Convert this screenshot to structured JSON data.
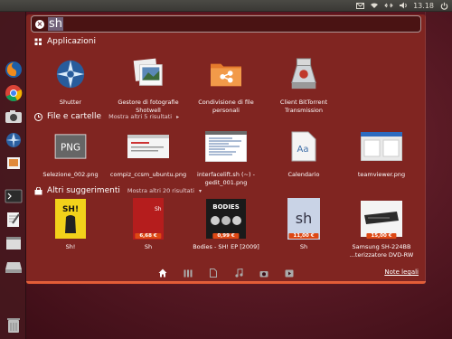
{
  "panel": {
    "time": "13.18"
  },
  "search": {
    "query": "sh"
  },
  "sections": {
    "apps": {
      "title": "Applicazioni"
    },
    "files": {
      "title": "File e cartelle",
      "more": "Mostra altri 5 risultati"
    },
    "suggestions": {
      "title": "Altri suggerimenti",
      "more": "Mostra altri 20 risultati"
    }
  },
  "apps": [
    {
      "label": "Shutter",
      "icon": "shutter-icon"
    },
    {
      "label": "Gestore di fotografie Shotwell",
      "icon": "shotwell-icon"
    },
    {
      "label": "Condivisione di file personali",
      "icon": "folder-share-icon"
    },
    {
      "label": "Client BitTorrent Transmission",
      "icon": "transmission-icon"
    }
  ],
  "files": [
    {
      "label": "Selezione_002.png"
    },
    {
      "label": "compiz_ccsm_ubuntu.png"
    },
    {
      "label": "interfacelift.sh (~) - gedit_001.png"
    },
    {
      "label": "Calendario"
    },
    {
      "label": "teamviewer.png"
    }
  ],
  "suggestions": [
    {
      "label": "Sh!",
      "price": ""
    },
    {
      "label": "Sh",
      "price": "6,68 €"
    },
    {
      "label": "Bodies - SH! EP [2009]",
      "price": "0,99 €",
      "cover_text": "BODIES"
    },
    {
      "label": "Sh",
      "price": "11,00 €",
      "cover_text": "sh"
    },
    {
      "label": "Samsung SH-224BB ...terizzatore DVD-RW",
      "price": "15,00 €"
    }
  ],
  "suggestion_covers": {
    "sh_yellow": "SH!",
    "sh_red": "Sh"
  },
  "footer": {
    "legal": "Note legali"
  },
  "lenses": [
    "home-lens-icon",
    "apps-lens-icon",
    "files-lens-icon",
    "music-lens-icon",
    "photos-lens-icon",
    "video-lens-icon"
  ],
  "colors": {
    "accent": "#dd4814",
    "dash_bg": "#5a141e"
  }
}
